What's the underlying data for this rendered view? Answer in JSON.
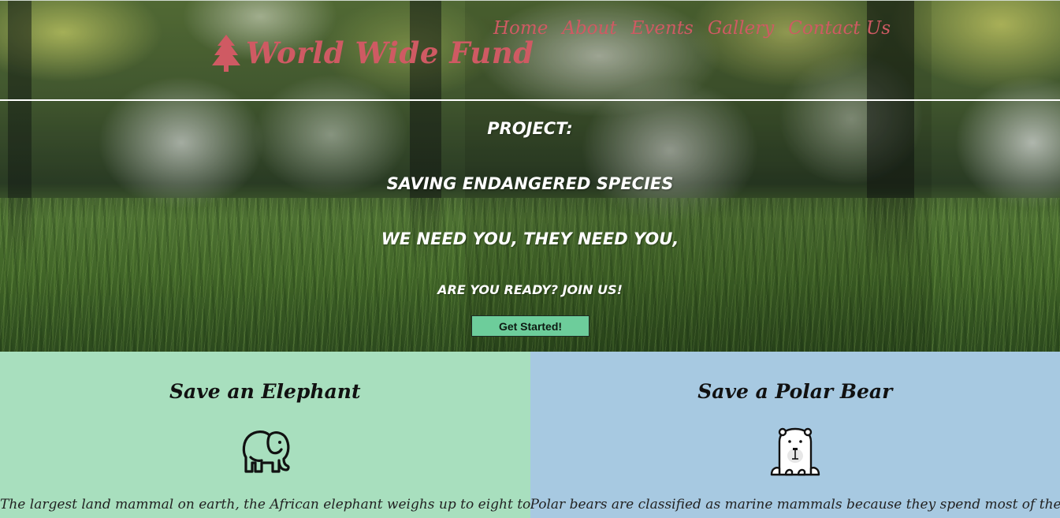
{
  "header": {
    "brand_name": "World Wide Fund",
    "logo_icon": "pine-tree-icon",
    "nav": [
      {
        "label": "Home"
      },
      {
        "label": "About"
      },
      {
        "label": "Events"
      },
      {
        "label": "Gallery"
      },
      {
        "label": "Contact Us"
      }
    ]
  },
  "hero": {
    "line1": "PROJECT:",
    "line2": "SAVING ENDANGERED SPECIES",
    "line3": "WE NEED YOU, THEY NEED YOU,",
    "line4": "ARE YOU READY? JOIN US!",
    "cta_label": "Get Started!"
  },
  "cards": [
    {
      "title": "Save an Elephant",
      "icon": "elephant-icon",
      "text": "The largest land mammal on earth, the African elephant weighs up to eight tons. The elephant is",
      "bg": "#a8dfbe"
    },
    {
      "title": "Save a Polar Bear",
      "icon": "polar-bear-icon",
      "text": "Polar bears are classified as marine mammals because they spend most of their lives on the sea ice of",
      "bg": "#a7c9e1"
    }
  ],
  "colors": {
    "brand": "#cf5a63",
    "cta": "#6dcd9b"
  }
}
